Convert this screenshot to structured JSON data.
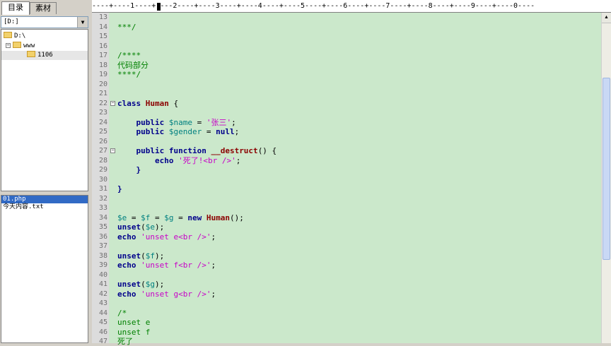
{
  "tabs": [
    {
      "label": "目录"
    },
    {
      "label": "素材"
    }
  ],
  "drive_select": {
    "value": "[D:]"
  },
  "tree": [
    {
      "label": "D:\\"
    },
    {
      "label": "www"
    },
    {
      "label": "1106"
    }
  ],
  "files": [
    {
      "name": "01.php",
      "selected": true
    },
    {
      "name": "今天内容.txt",
      "selected": false
    }
  ],
  "ruler": {
    "text": "----+----1----+----2----+----3----+----4----+----5----+----6----+----7----+----8----+----9----+----0----"
  },
  "editor": {
    "lines": [
      {
        "n": "13",
        "tokens": []
      },
      {
        "n": "14",
        "tokens": [
          {
            "t": "***/",
            "c": "com"
          }
        ]
      },
      {
        "n": "15",
        "tokens": []
      },
      {
        "n": "16",
        "tokens": []
      },
      {
        "n": "17",
        "tokens": [
          {
            "t": "/****",
            "c": "com"
          }
        ]
      },
      {
        "n": "18",
        "tokens": [
          {
            "t": "代码部分",
            "c": "com"
          }
        ]
      },
      {
        "n": "19",
        "tokens": [
          {
            "t": "****/",
            "c": "com"
          }
        ]
      },
      {
        "n": "20",
        "tokens": []
      },
      {
        "n": "21",
        "tokens": []
      },
      {
        "n": "22",
        "fold": true,
        "tokens": [
          {
            "t": "class ",
            "c": "kw"
          },
          {
            "t": "Human",
            "c": "cls"
          },
          {
            "t": " {",
            "c": "p"
          }
        ]
      },
      {
        "n": "23",
        "tokens": []
      },
      {
        "n": "24",
        "tokens": [
          {
            "t": "    public ",
            "c": "kw"
          },
          {
            "t": "$name",
            "c": "var"
          },
          {
            "t": " = ",
            "c": "p"
          },
          {
            "t": "'张三'",
            "c": "str"
          },
          {
            "t": ";",
            "c": "p"
          }
        ]
      },
      {
        "n": "25",
        "tokens": [
          {
            "t": "    public ",
            "c": "kw"
          },
          {
            "t": "$gender",
            "c": "var"
          },
          {
            "t": " = ",
            "c": "p"
          },
          {
            "t": "null",
            "c": "kw"
          },
          {
            "t": ";",
            "c": "p"
          }
        ]
      },
      {
        "n": "26",
        "tokens": []
      },
      {
        "n": "27",
        "fold": true,
        "tokens": [
          {
            "t": "    public function ",
            "c": "kw"
          },
          {
            "t": "__destruct",
            "c": "fn"
          },
          {
            "t": "() {",
            "c": "p"
          }
        ]
      },
      {
        "n": "28",
        "tokens": [
          {
            "t": "        echo ",
            "c": "kw"
          },
          {
            "t": "'死了!<br />'",
            "c": "str"
          },
          {
            "t": ";",
            "c": "p"
          }
        ]
      },
      {
        "n": "29",
        "tokens": [
          {
            "t": "    }",
            "c": "kw"
          }
        ]
      },
      {
        "n": "30",
        "tokens": []
      },
      {
        "n": "31",
        "tokens": [
          {
            "t": "}",
            "c": "kw"
          }
        ]
      },
      {
        "n": "32",
        "tokens": []
      },
      {
        "n": "33",
        "tokens": []
      },
      {
        "n": "34",
        "tokens": [
          {
            "t": "$e",
            "c": "var"
          },
          {
            "t": " = ",
            "c": "p"
          },
          {
            "t": "$f",
            "c": "var"
          },
          {
            "t": " = ",
            "c": "p"
          },
          {
            "t": "$g",
            "c": "var"
          },
          {
            "t": " = ",
            "c": "p"
          },
          {
            "t": "new ",
            "c": "kw"
          },
          {
            "t": "Human",
            "c": "cls"
          },
          {
            "t": "();",
            "c": "p"
          }
        ]
      },
      {
        "n": "35",
        "tokens": [
          {
            "t": "unset",
            "c": "kw"
          },
          {
            "t": "(",
            "c": "p"
          },
          {
            "t": "$e",
            "c": "var"
          },
          {
            "t": ");",
            "c": "p"
          }
        ]
      },
      {
        "n": "36",
        "tokens": [
          {
            "t": "echo ",
            "c": "kw"
          },
          {
            "t": "'unset e<br />'",
            "c": "str"
          },
          {
            "t": ";",
            "c": "p"
          }
        ]
      },
      {
        "n": "37",
        "tokens": []
      },
      {
        "n": "38",
        "tokens": [
          {
            "t": "unset",
            "c": "kw"
          },
          {
            "t": "(",
            "c": "p"
          },
          {
            "t": "$f",
            "c": "var"
          },
          {
            "t": ");",
            "c": "p"
          }
        ]
      },
      {
        "n": "39",
        "tokens": [
          {
            "t": "echo ",
            "c": "kw"
          },
          {
            "t": "'unset f<br />'",
            "c": "str"
          },
          {
            "t": ";",
            "c": "p"
          }
        ]
      },
      {
        "n": "40",
        "tokens": []
      },
      {
        "n": "41",
        "tokens": [
          {
            "t": "unset",
            "c": "kw"
          },
          {
            "t": "(",
            "c": "p"
          },
          {
            "t": "$g",
            "c": "var"
          },
          {
            "t": ");",
            "c": "p"
          }
        ]
      },
      {
        "n": "42",
        "tokens": [
          {
            "t": "echo ",
            "c": "kw"
          },
          {
            "t": "'unset g<br />'",
            "c": "str"
          },
          {
            "t": ";",
            "c": "p"
          }
        ]
      },
      {
        "n": "43",
        "tokens": []
      },
      {
        "n": "44",
        "tokens": [
          {
            "t": "/*",
            "c": "com"
          }
        ]
      },
      {
        "n": "45",
        "tokens": [
          {
            "t": "unset e",
            "c": "com"
          }
        ]
      },
      {
        "n": "46",
        "tokens": [
          {
            "t": "unset f",
            "c": "com"
          }
        ]
      },
      {
        "n": "47",
        "tokens": [
          {
            "t": "死了",
            "c": "com"
          }
        ]
      }
    ]
  },
  "colors": {
    "editor_bg": "#cbe8cb",
    "keyword": "#00008b",
    "variable": "#008080",
    "string": "#c800c8",
    "comment": "#008000",
    "classname": "#8b0000",
    "selection": "#316ac5"
  }
}
